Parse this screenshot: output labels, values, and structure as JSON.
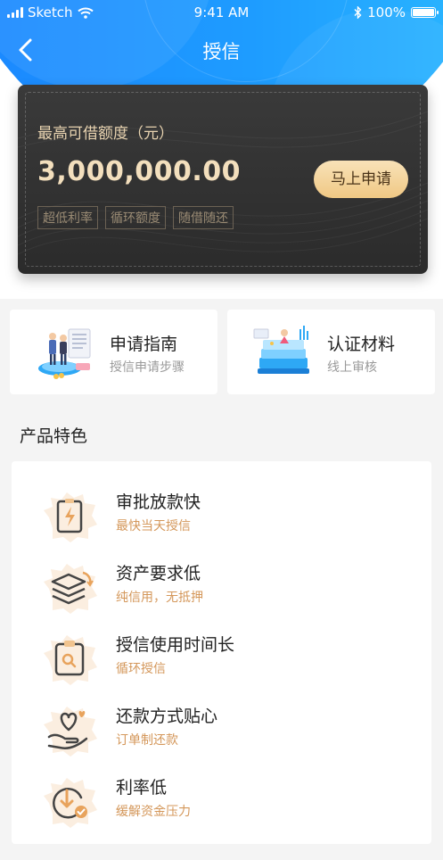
{
  "status_bar": {
    "carrier": "Sketch",
    "time": "9:41 AM",
    "battery": "100%"
  },
  "navbar": {
    "title": "授信"
  },
  "credit_card": {
    "label": "最高可借额度（元）",
    "amount": "3,000,000.00",
    "apply_label": "马上申请",
    "tags": [
      "超低利率",
      "循环额度",
      "随借随还"
    ]
  },
  "quick_links": [
    {
      "title": "申请指南",
      "subtitle": "授信申请步骤",
      "icon": "guide-illustration"
    },
    {
      "title": "认证材料",
      "subtitle": "线上审核",
      "icon": "materials-illustration"
    }
  ],
  "features_section": {
    "title": "产品特色",
    "items": [
      {
        "title": "审批放款快",
        "subtitle": "最快当天授信",
        "icon": "lightning-document-icon"
      },
      {
        "title": "资产要求低",
        "subtitle": "纯信用，无抵押",
        "icon": "stack-layers-icon"
      },
      {
        "title": "授信使用时间长",
        "subtitle": "循环授信",
        "icon": "clipboard-search-icon"
      },
      {
        "title": "还款方式贴心",
        "subtitle": "订单制还款",
        "icon": "heart-hand-icon"
      },
      {
        "title": "利率低",
        "subtitle": "缓解资金压力",
        "icon": "down-arrow-check-icon"
      }
    ]
  },
  "colors": {
    "header_blue": "#1e9cff",
    "card_dark": "#333333",
    "gold_text": "#f3dfbd",
    "accent_orange": "#d4975a"
  }
}
